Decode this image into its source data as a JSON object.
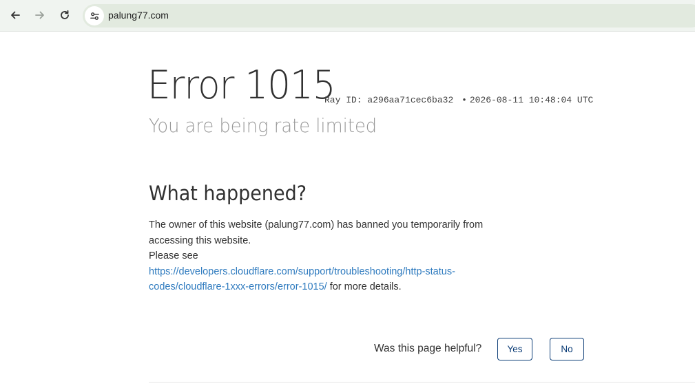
{
  "browser": {
    "url": "palung77.com",
    "back_icon": "arrow-left-icon",
    "forward_icon": "arrow-right-icon",
    "reload_icon": "reload-icon",
    "site_info_icon": "tune-icon"
  },
  "error": {
    "title": "Error 1015",
    "ray_label": "Ray ID:",
    "ray_id": "a296aa71cec6ba32",
    "separator": "•",
    "timestamp": "2026-08-11 10:48:04 UTC",
    "subtitle": "You are being rate limited"
  },
  "what_happened": {
    "heading": "What happened?",
    "line1": "The owner of this website (palung77.com) has banned you temporarily from accessing this website.",
    "line2": "Please see",
    "link": "https://developers.cloudflare.com/support/troubleshooting/http-status-codes/cloudflare-1xxx-errors/error-1015/",
    "suffix": " for more details."
  },
  "feedback": {
    "question": "Was this page helpful?",
    "yes": "Yes",
    "no": "No"
  },
  "colors": {
    "link": "#2f7bbf",
    "button_border": "#0b3c76",
    "toolbar_bg": "#f0f4f0",
    "omnibox_bg": "#e2eadf"
  }
}
